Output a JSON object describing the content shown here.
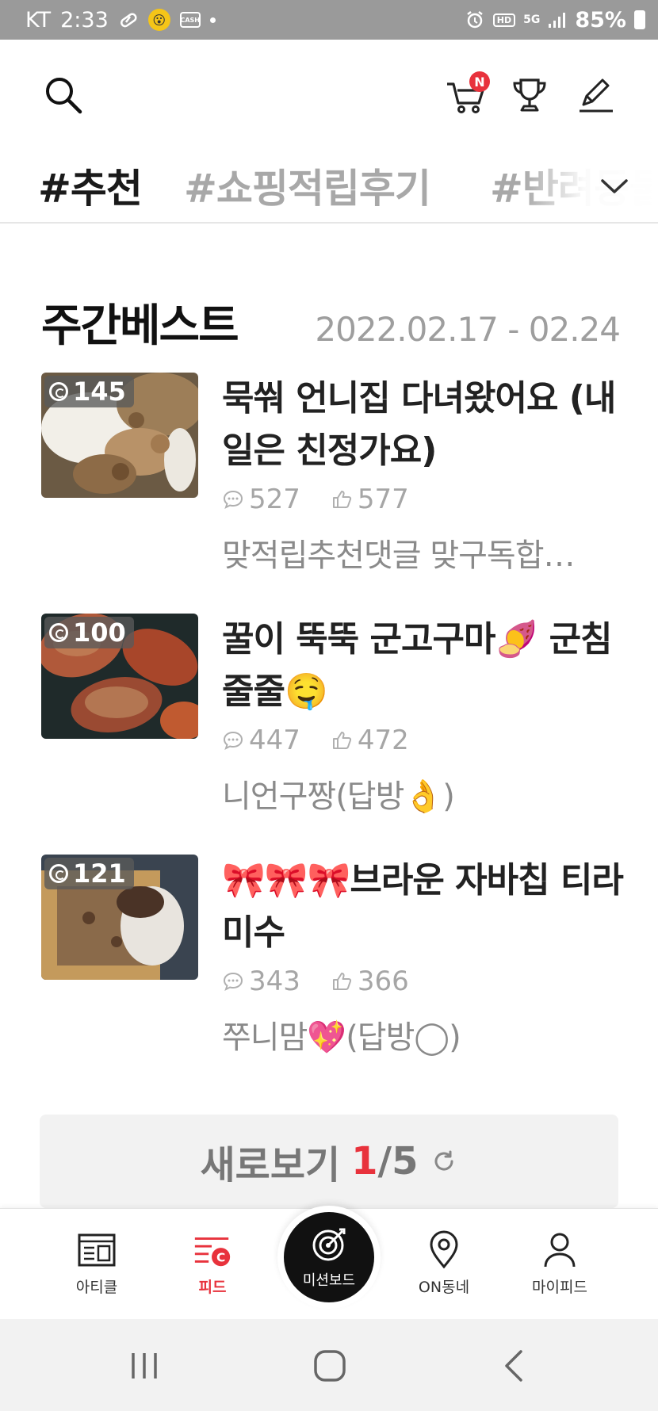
{
  "status_bar": {
    "carrier": "KT",
    "time": "2:33",
    "cash_label": "CASH",
    "hd_label": "HD",
    "network": "5G",
    "battery": "85%"
  },
  "header": {
    "cart_badge": "N"
  },
  "tabs": [
    {
      "label": "#추천",
      "active": true
    },
    {
      "label": "#쇼핑적립후기",
      "active": false
    },
    {
      "label": "#반려동물",
      "active": false
    }
  ],
  "weekly_best": {
    "title": "주간베스트",
    "date_range": "2022.02.17 - 02.24",
    "posts": [
      {
        "title": "묵쒀 언니집 다녀왔어요 (내일은 친정가요)",
        "cash": "145",
        "comments": "527",
        "likes": "577",
        "author": "맞적립추천댓글 맞구독합…",
        "thumb": "cookies"
      },
      {
        "title": "꿀이 뚝뚝 군고구마🍠 군침 줄줄🤤",
        "cash": "100",
        "comments": "447",
        "likes": "472",
        "author": "니언구짱(답방👌)",
        "thumb": "sweet-potatoes"
      },
      {
        "title": "🎀🎀🎀브라운 자바칩 티라미수",
        "cash": "121",
        "comments": "343",
        "likes": "366",
        "author": "쭈니맘💖(답방◯)",
        "thumb": "tiramisu"
      }
    ]
  },
  "refresh": {
    "label": "새로보기",
    "current": "1",
    "total": "/5"
  },
  "bottom_nav": {
    "items": [
      {
        "label": "아티클",
        "icon": "article-icon",
        "active": false
      },
      {
        "label": "피드",
        "icon": "feed-icon",
        "active": true
      },
      {
        "label": "미션보드",
        "icon": "target-icon",
        "active": false
      },
      {
        "label": "ON동네",
        "icon": "location-pin-icon",
        "active": false
      },
      {
        "label": "마이피드",
        "icon": "person-icon",
        "active": false
      }
    ]
  },
  "colors": {
    "accent_red": "#e8323c",
    "inactive_gray": "#a8a8a8",
    "status_bar_bg": "#9a9a9a"
  }
}
